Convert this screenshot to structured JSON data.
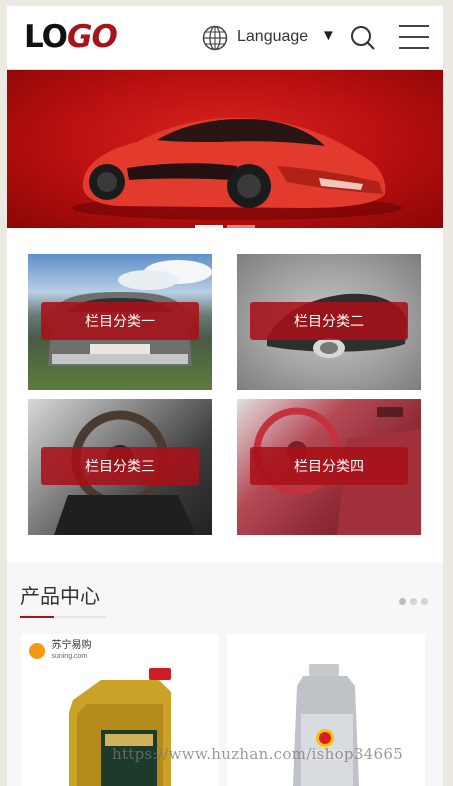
{
  "header": {
    "logo_part1": "LO",
    "logo_part2": "GO",
    "language_label": "Language",
    "language_caret": "▼",
    "icons": [
      "globe-icon",
      "search-icon",
      "menu-icon"
    ]
  },
  "banner": {
    "slide_count": 2,
    "active_slide": 0
  },
  "categories": [
    {
      "label": "栏目分类一"
    },
    {
      "label": "栏目分类二"
    },
    {
      "label": "栏目分类三"
    },
    {
      "label": "栏目分类四"
    }
  ],
  "products": {
    "title": "产品中心",
    "pager_count": 3,
    "active_page": 0,
    "items": [
      {
        "store_logo": "苏宁易购",
        "store_domain": "suning.com"
      },
      {
        "store_logo": "",
        "store_domain": ""
      }
    ]
  },
  "watermark": "https://www.huzhan.com/ishop34665",
  "colors": {
    "brand": "#a4141a",
    "banner": "#c01414",
    "category_label_bg": "#a81018"
  }
}
